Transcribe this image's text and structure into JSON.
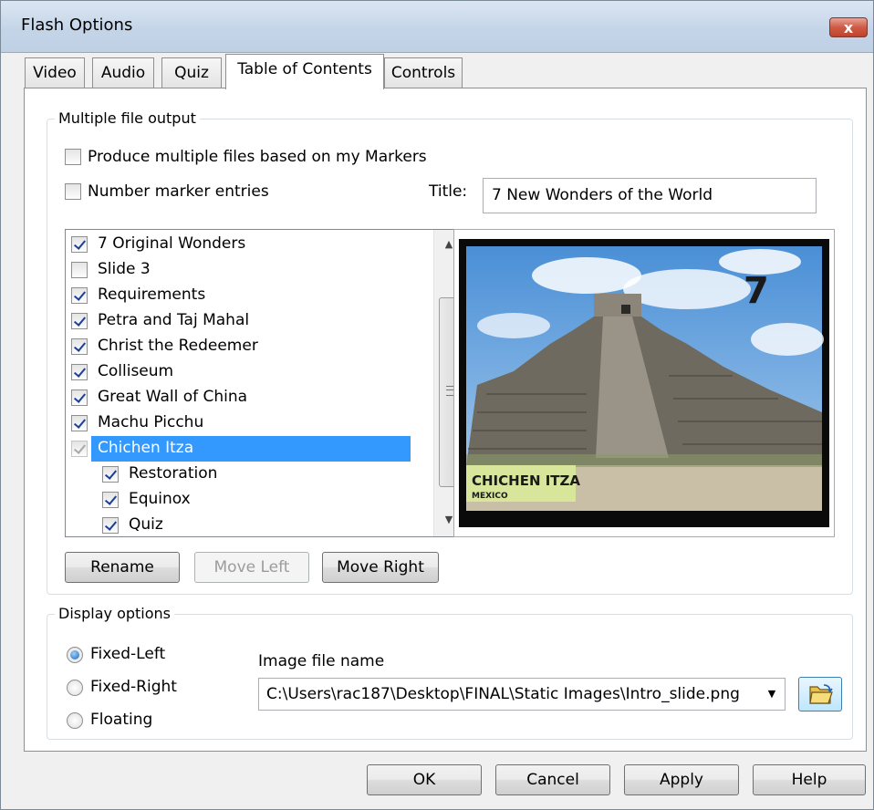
{
  "window": {
    "title": "Flash Options",
    "close_label": "x"
  },
  "tabs": [
    {
      "label": "Video"
    },
    {
      "label": "Audio"
    },
    {
      "label": "Quiz"
    },
    {
      "label": "Table of Contents",
      "active": true
    },
    {
      "label": "Controls"
    }
  ],
  "multiple_file_output": {
    "legend": "Multiple file output",
    "produce_multiple": {
      "label": "Produce multiple files based on my Markers",
      "checked": false
    },
    "number_entries": {
      "label": "Number marker entries",
      "checked": false
    },
    "title_label": "Title:",
    "title_value": "7 New Wonders of the World",
    "items": [
      {
        "label": "7 Original Wonders",
        "checked": true
      },
      {
        "label": "Slide 3",
        "checked": false
      },
      {
        "label": "Requirements",
        "checked": true
      },
      {
        "label": "Petra and Taj Mahal",
        "checked": true
      },
      {
        "label": "Christ the Redeemer",
        "checked": true
      },
      {
        "label": "Colliseum",
        "checked": true
      },
      {
        "label": "Great Wall of China",
        "checked": true
      },
      {
        "label": "Machu Picchu",
        "checked": true
      },
      {
        "label": "Chichen Itza",
        "checked": true,
        "selected": true
      },
      {
        "label": "Restoration",
        "checked": true,
        "indent": true
      },
      {
        "label": "Equinox",
        "checked": true,
        "indent": true
      },
      {
        "label": "Quiz",
        "checked": true,
        "indent": true
      }
    ],
    "buttons": {
      "rename": "Rename",
      "move_left": "Move Left",
      "move_right": "Move Right"
    }
  },
  "preview": {
    "number": "7",
    "caption_title": "CHICHEN ITZA",
    "caption_sub": "MEXICO"
  },
  "display_options": {
    "legend": "Display options",
    "radios": [
      {
        "label": "Fixed-Left",
        "checked": true
      },
      {
        "label": "Fixed-Right",
        "checked": false
      },
      {
        "label": "Floating",
        "checked": false
      }
    ],
    "image_file_label": "Image file name",
    "image_file_value": "C:\\Users\\rac187\\Desktop\\FINAL\\Static Images\\Intro_slide.png"
  },
  "footer": {
    "ok": "OK",
    "cancel": "Cancel",
    "apply": "Apply",
    "help": "Help"
  },
  "colors": {
    "selection": "#3399ff",
    "titlebar": "#c5d5e8",
    "close": "#c2412b"
  }
}
